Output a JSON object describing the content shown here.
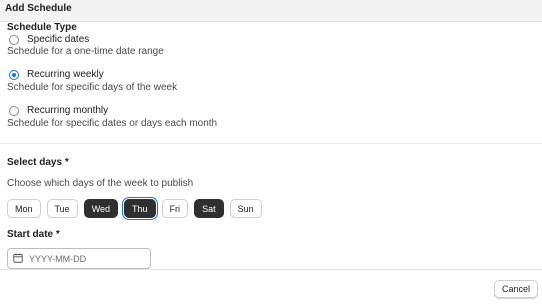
{
  "dialog": {
    "title": "Add Schedule"
  },
  "schedule_type": {
    "label": "Schedule Type",
    "options": [
      {
        "label": "Specific dates",
        "help": "Schedule for a one-time date range",
        "selected": false
      },
      {
        "label": "Recurring weekly",
        "help": "Schedule for specific days of the week",
        "selected": true
      },
      {
        "label": "Recurring monthly",
        "help": "Schedule for specific dates or days each month",
        "selected": false
      }
    ]
  },
  "select_days": {
    "label": "Select days *",
    "help": "Choose which days of the week to publish",
    "days": [
      {
        "label": "Mon",
        "selected": false
      },
      {
        "label": "Tue",
        "selected": false
      },
      {
        "label": "Wed",
        "selected": true
      },
      {
        "label": "Thu",
        "selected": true,
        "focused": true
      },
      {
        "label": "Fri",
        "selected": false
      },
      {
        "label": "Sat",
        "selected": true
      },
      {
        "label": "Sun",
        "selected": false
      }
    ]
  },
  "start_date": {
    "label": "Start date *",
    "placeholder": "YYYY-MM-DD",
    "icon": "calendar-icon"
  },
  "footer": {
    "cancel_label": "Cancel"
  },
  "colors": {
    "accent": "#1a73e8",
    "selected_day_bg": "#2f2f2f"
  }
}
